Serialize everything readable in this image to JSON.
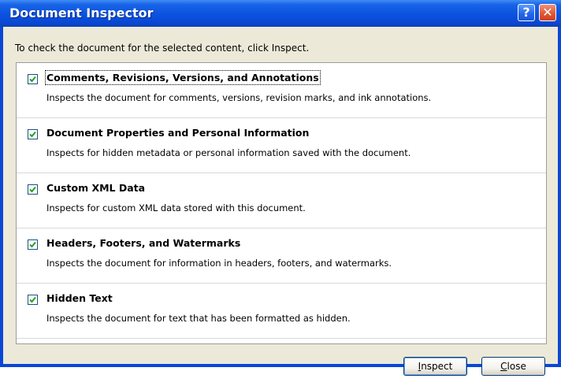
{
  "window": {
    "title": "Document Inspector",
    "help_glyph": "?",
    "close_glyph": "✕"
  },
  "instruction": "To check the document for the selected content, click Inspect.",
  "items": [
    {
      "checked": true,
      "title": "Comments, Revisions, Versions, and Annotations",
      "description": "Inspects the document for comments, versions, revision marks, and ink annotations."
    },
    {
      "checked": true,
      "title": "Document Properties and Personal Information",
      "description": "Inspects for hidden metadata or personal information saved with the document."
    },
    {
      "checked": true,
      "title": "Custom XML Data",
      "description": "Inspects for custom XML data stored with this document."
    },
    {
      "checked": true,
      "title": "Headers, Footers, and Watermarks",
      "description": "Inspects the document for information in headers, footers, and watermarks."
    },
    {
      "checked": true,
      "title": "Hidden Text",
      "description": "Inspects the document for text that has been formatted as hidden."
    }
  ],
  "buttons": {
    "inspect": {
      "mnemonic": "I",
      "rest": "nspect"
    },
    "close": {
      "mnemonic": "C",
      "rest": "lose"
    }
  },
  "colors": {
    "titlebar": "#0a48d3",
    "dialog_face": "#ece9d8",
    "checkmark": "#21a121"
  },
  "icons": [
    "help-icon",
    "close-icon",
    "checkmark-icon"
  ]
}
